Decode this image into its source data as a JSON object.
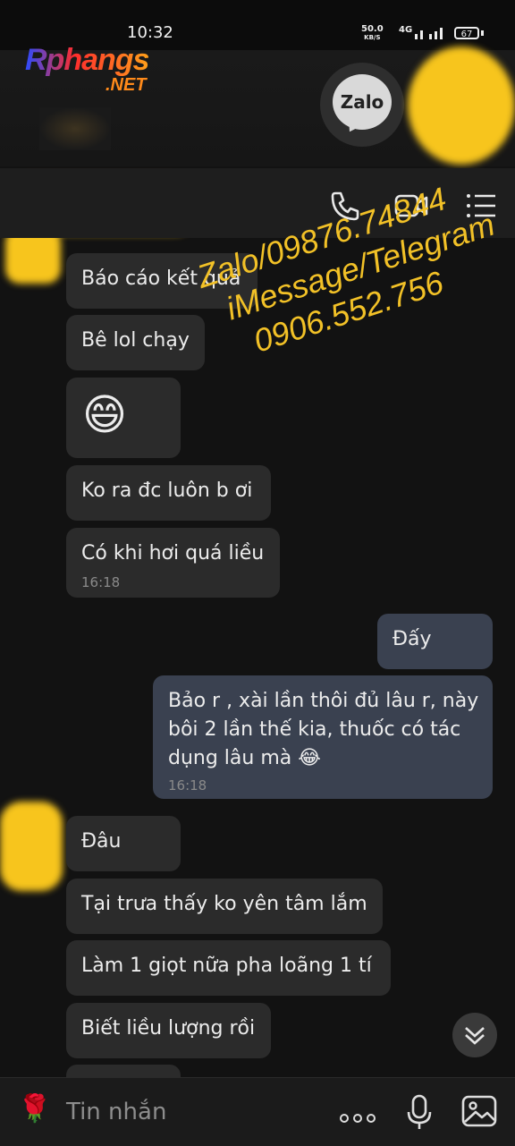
{
  "status": {
    "time": "10:32",
    "speed_value": "50.0",
    "speed_unit": "KB/S",
    "network": "4G",
    "battery": "67"
  },
  "logo": {
    "main": "Rphangs",
    "sub": ".NET"
  },
  "zalo_badge": "Zalo",
  "header_icons": [
    "phone-icon",
    "video-call-icon",
    "menu-list-icon"
  ],
  "messages": [
    {
      "id": "m1",
      "text": "Báo cáo kết quả",
      "dir": "in"
    },
    {
      "id": "m2",
      "text": "Bê lol chạy",
      "dir": "in"
    },
    {
      "id": "m3",
      "text": "😄",
      "dir": "in"
    },
    {
      "id": "m4",
      "text": "Ko ra đc luôn b ơi",
      "dir": "in"
    },
    {
      "id": "m5",
      "text": "Có khi hơi quá liều",
      "time": "16:18",
      "dir": "in"
    },
    {
      "id": "m6",
      "text": "Đấy",
      "dir": "out"
    },
    {
      "id": "m7",
      "lines": [
        "Bảo r , xài lần thôi đủ lâu r, này",
        "bôi 2 lần thế kia, thuốc có tác",
        "dụng lâu mà 😂"
      ],
      "time": "16:18",
      "dir": "out"
    },
    {
      "id": "m8",
      "text": "Đâu",
      "dir": "in"
    },
    {
      "id": "m9",
      "text": "Tại trưa thấy ko yên tâm lắm",
      "dir": "in"
    },
    {
      "id": "m10",
      "text": "Làm 1 giọt nữa pha loãng 1 tí",
      "dir": "in"
    },
    {
      "id": "m11",
      "text": "Biết liều lượng rồi",
      "dir": "in"
    }
  ],
  "watermark": [
    "Zalo/09876.74844",
    "iMessage/Telegram",
    "0906.552.756"
  ],
  "composer": {
    "placeholder": "Tin nhắn",
    "sticker": "🌹"
  },
  "colors": {
    "background": "#121212",
    "incoming_bubble": "#2b2b2b",
    "outgoing_bubble": "#3a4150",
    "watermark": "#f2c127",
    "censor": "#f7c51d"
  }
}
